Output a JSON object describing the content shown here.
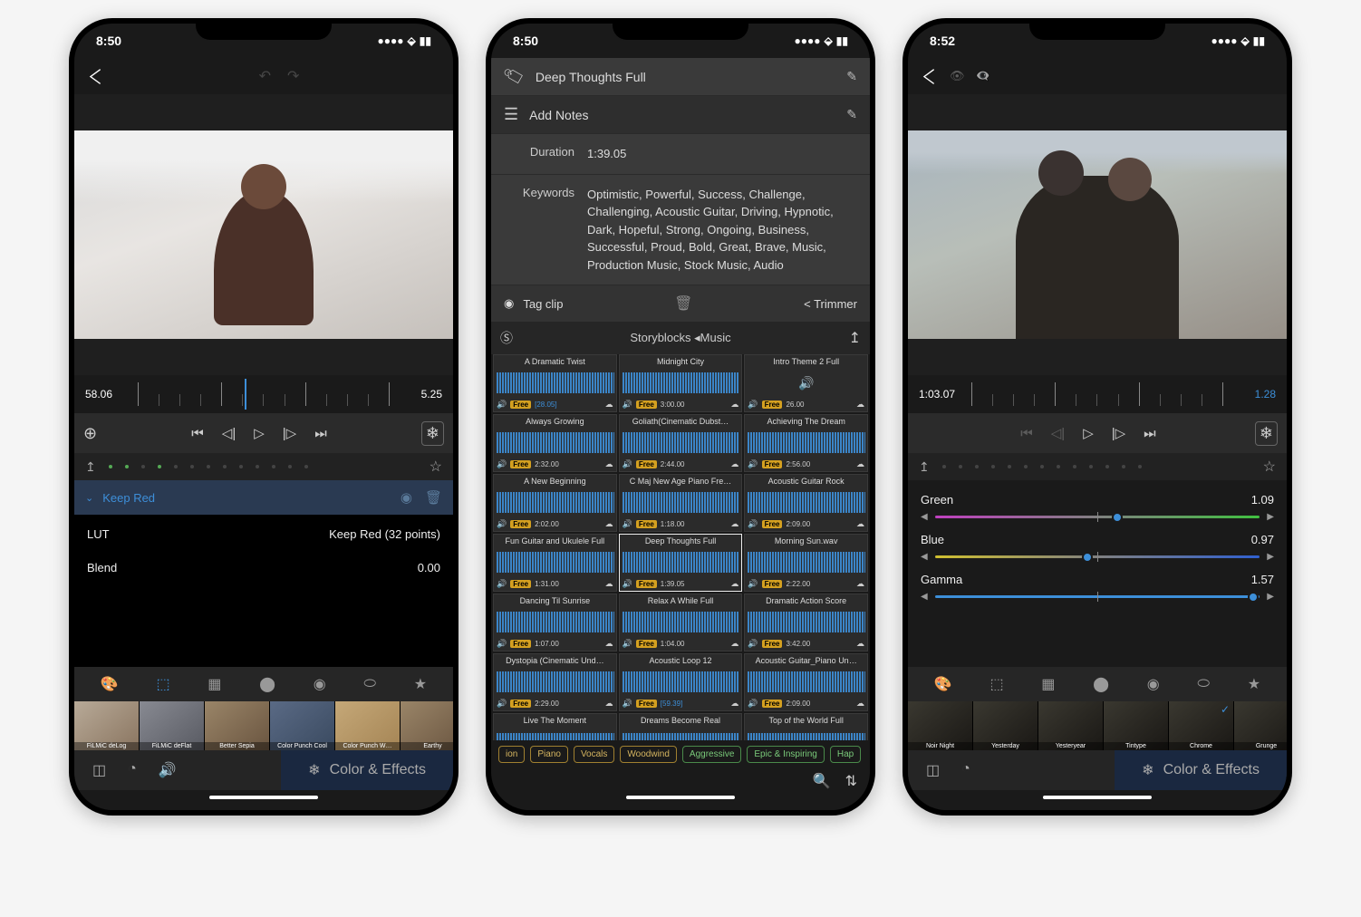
{
  "status": {
    "time1": "8:50",
    "time2": "8:50",
    "time3": "8:52"
  },
  "p1": {
    "tl_left": "58.06",
    "tl_right": "5.25",
    "eff_name": "Keep Red",
    "lut_label": "LUT",
    "lut_value": "Keep Red (32 points)",
    "blend_label": "Blend",
    "blend_value": "0.00",
    "luts": [
      "FiLMiC deLog",
      "FiLMiC deFlat",
      "Better Sepia",
      "Color Punch Cool",
      "Color Punch W…",
      "Earthy"
    ],
    "bottom_tab": "Color & Effects"
  },
  "p2": {
    "title": "Deep Thoughts Full",
    "notes": "Add Notes",
    "duration_k": "Duration",
    "duration_v": "1:39.05",
    "keywords_k": "Keywords",
    "keywords_v": "Optimistic, Powerful, Success, Challenge, Challenging, Acoustic Guitar, Driving, Hypnotic, Dark, Hopeful, Strong, Ongoing, Business, Successful, Proud, Bold, Great, Brave, Music, Production Music, Stock Music, Audio",
    "tag": "Tag clip",
    "trimmer": "< Trimmer",
    "mus_head": "Storyblocks ◂Music",
    "free": "Free",
    "tracks": [
      [
        {
          "t": "A Dramatic Twist",
          "d": "[28.05]",
          "b": true
        },
        {
          "t": "Midnight City",
          "d": "3:00.00"
        },
        {
          "t": "Intro Theme 2 Full",
          "d": "26.00",
          "nosig": true
        }
      ],
      [
        {
          "t": "Always Growing",
          "d": "2:32.00"
        },
        {
          "t": "Goliath(Cinematic Dubst…",
          "d": "2:44.00"
        },
        {
          "t": "Achieving The Dream",
          "d": "2:56.00"
        }
      ],
      [
        {
          "t": "A New Beginning",
          "d": "2:02.00"
        },
        {
          "t": "C Maj New Age Piano Fre…",
          "d": "1:18.00"
        },
        {
          "t": "Acoustic Guitar Rock",
          "d": "2:09.00"
        }
      ],
      [
        {
          "t": "Fun Guitar and Ukulele Full",
          "d": "1:31.00"
        },
        {
          "t": "Deep Thoughts Full",
          "d": "1:39.05",
          "sel": true
        },
        {
          "t": "Morning Sun.wav",
          "d": "2:22.00"
        }
      ],
      [
        {
          "t": "Dancing Til Sunrise",
          "d": "1:07.00"
        },
        {
          "t": "Relax A While Full",
          "d": "1:04.00"
        },
        {
          "t": "Dramatic Action Score",
          "d": "3:42.00"
        }
      ],
      [
        {
          "t": "Dystopia (Cinematic Und…",
          "d": "2:29.00"
        },
        {
          "t": "Acoustic Loop 12",
          "d": "[59.39]",
          "b": true
        },
        {
          "t": "Acoustic Guitar_Piano Un…",
          "d": "2:09.00"
        }
      ],
      [
        {
          "t": "Live The Moment",
          "d": ""
        },
        {
          "t": "Dreams Become Real",
          "d": ""
        },
        {
          "t": "Top of the World Full",
          "d": ""
        }
      ]
    ],
    "tags": [
      {
        "t": "ion"
      },
      {
        "t": "Piano"
      },
      {
        "t": "Vocals"
      },
      {
        "t": "Woodwind"
      },
      {
        "t": "Aggressive",
        "g": true
      },
      {
        "t": "Epic & Inspiring",
        "g": true
      },
      {
        "t": "Hap",
        "g": true
      }
    ]
  },
  "p3": {
    "tl_left": "1:03.07",
    "tl_right": "1.28",
    "sliders": [
      {
        "name": "Green",
        "val": "1.09",
        "cls": "green",
        "pos": 56
      },
      {
        "name": "Blue",
        "val": "0.97",
        "cls": "blue",
        "pos": 47
      },
      {
        "name": "Gamma",
        "val": "1.57",
        "cls": "gamma",
        "pos": 98
      }
    ],
    "luts": [
      "Noir Night",
      "Yesterday",
      "Yesteryear",
      "Tintype",
      "Chrome",
      "Grunge"
    ],
    "bottom_tab": "Color & Effects"
  }
}
